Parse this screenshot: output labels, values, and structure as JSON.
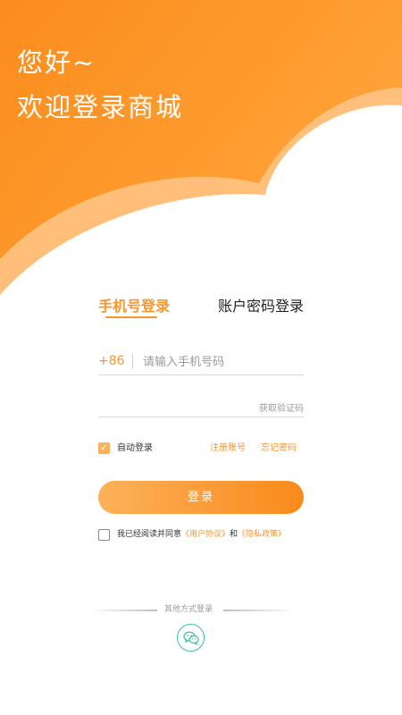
{
  "theme": {
    "accent": "#f8962f",
    "gradient_start": "#fdb15a",
    "gradient_end": "#f98a1c",
    "wechat": "#3cc29b"
  },
  "header": {
    "greeting_line1": "您好~",
    "greeting_line2": "欢迎登录商城"
  },
  "tabs": [
    {
      "label": "手机号登录",
      "active": true
    },
    {
      "label": "账户密码登录",
      "active": false
    }
  ],
  "form": {
    "country_code": "+86",
    "phone_placeholder": "请输入手机号码",
    "code_placeholder": "",
    "get_code_label": "获取验证码"
  },
  "options": {
    "auto_login_label": "自动登录",
    "auto_login_checked": true,
    "register_label": "注册账号",
    "forgot_label": "忘记密码"
  },
  "login_button": "登录",
  "agreement": {
    "checked": false,
    "prefix": "我已经阅读并同意",
    "user_agreement": "《用户协议》",
    "and": "和",
    "privacy_policy": "《隐私政策》"
  },
  "other_login": {
    "label": "其他方式登录",
    "icons": [
      "wechat-icon"
    ]
  }
}
